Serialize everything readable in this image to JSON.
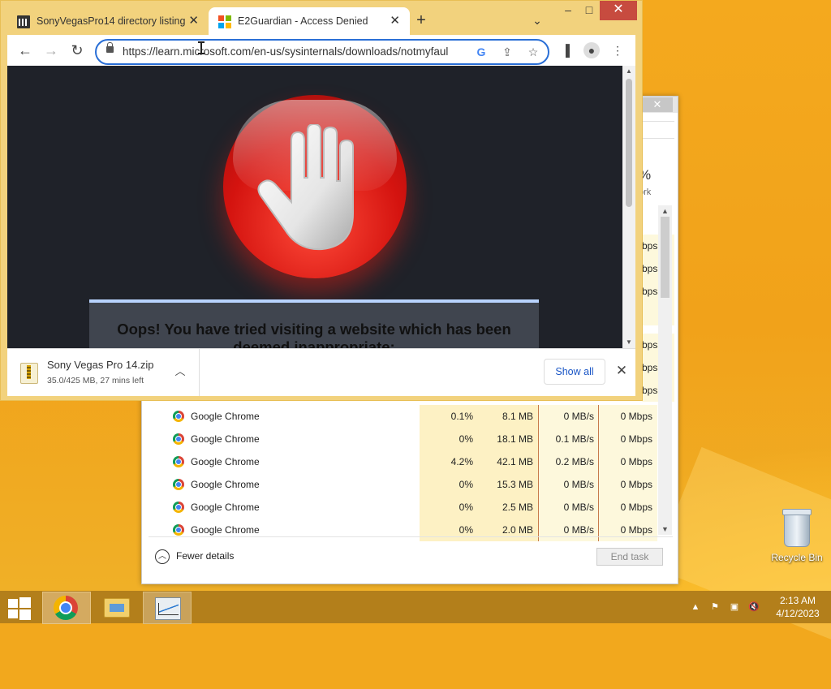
{
  "browser": {
    "tabs": [
      {
        "title": "SonyVegasPro14 directory listing",
        "icon": "library-icon",
        "active": false
      },
      {
        "title": "E2Guardian - Access Denied",
        "icon": "microsoft-icon",
        "active": true
      }
    ],
    "url": "https://learn.microsoft.com/en-us/sysinternals/downloads/notmyfaul",
    "page": {
      "message": "Oops! You have tried visiting a website which has been deemed inappropriate:"
    },
    "download": {
      "filename": "Sony Vegas Pro 14.zip",
      "status": "35.0/425 MB, 27 mins left",
      "show_all": "Show all"
    }
  },
  "taskmgr": {
    "network_header": "%",
    "network_sub": "ork",
    "partial_rows": [
      "bps",
      "bps",
      "bps",
      "",
      "bps",
      "bps",
      "bps"
    ],
    "rows": [
      {
        "name": "Google Chrome",
        "cpu": "0.1%",
        "memory": "8.1 MB",
        "disk": "0 MB/s",
        "network": "0 Mbps"
      },
      {
        "name": "Google Chrome",
        "cpu": "0%",
        "memory": "18.1 MB",
        "disk": "0.1 MB/s",
        "network": "0 Mbps"
      },
      {
        "name": "Google Chrome",
        "cpu": "4.2%",
        "memory": "42.1 MB",
        "disk": "0.2 MB/s",
        "network": "0 Mbps"
      },
      {
        "name": "Google Chrome",
        "cpu": "0%",
        "memory": "15.3 MB",
        "disk": "0 MB/s",
        "network": "0 Mbps"
      },
      {
        "name": "Google Chrome",
        "cpu": "0%",
        "memory": "2.5 MB",
        "disk": "0 MB/s",
        "network": "0 Mbps"
      },
      {
        "name": "Google Chrome",
        "cpu": "0%",
        "memory": "2.0 MB",
        "disk": "0 MB/s",
        "network": "0 Mbps"
      }
    ],
    "fewer_details": "Fewer details",
    "end_task": "End task"
  },
  "desktop": {
    "recycle_bin": "Recycle Bin"
  },
  "taskbar": {
    "time": "2:13 AM",
    "date": "4/12/2023"
  },
  "colors": {
    "accent_blue": "#2a6fd6",
    "stop_red": "#d4130f",
    "taskbar": "#b37f1b"
  }
}
